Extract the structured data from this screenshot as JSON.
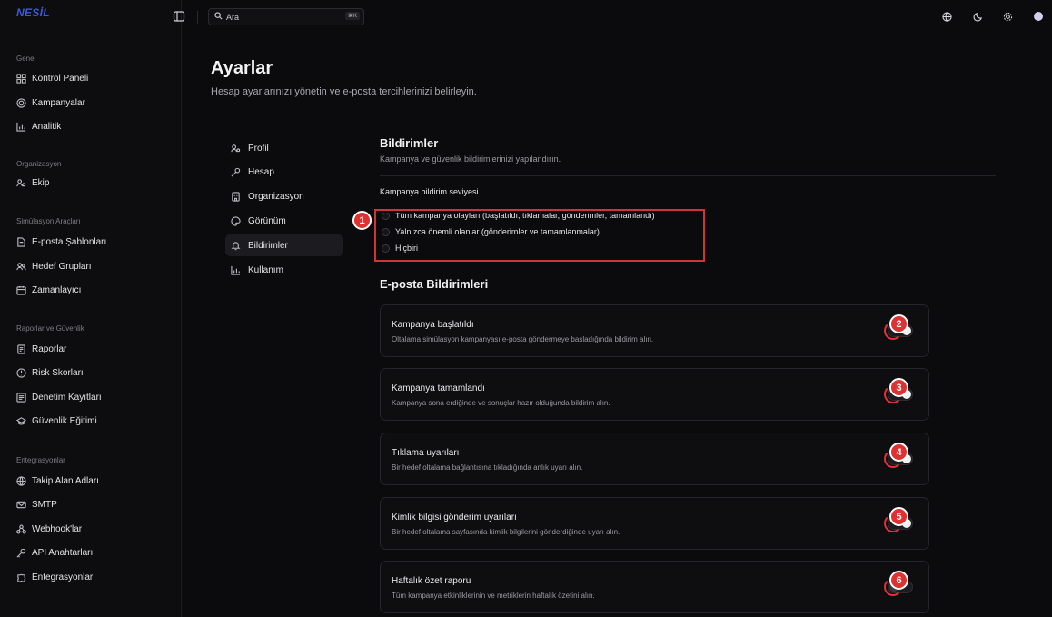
{
  "brand": {
    "logo": "NESİL"
  },
  "topbar": {
    "search_placeholder": "Ara",
    "search_shortcut": "⌘K",
    "icons": [
      "sidebar-toggle-icon",
      "globe-icon",
      "moon-icon",
      "gear-icon",
      "avatar"
    ]
  },
  "sidebar": {
    "sections": [
      {
        "title": "Genel",
        "items": [
          {
            "label": "Kontrol Paneli",
            "icon": "grid-icon"
          },
          {
            "label": "Kampanyalar",
            "icon": "target-icon"
          },
          {
            "label": "Analitik",
            "icon": "chart-icon"
          }
        ]
      },
      {
        "title": "Organizasyon",
        "items": [
          {
            "label": "Ekip",
            "icon": "users-icon"
          }
        ]
      },
      {
        "title": "Simülasyon Araçları",
        "items": [
          {
            "label": "E-posta Şablonları",
            "icon": "file-icon"
          },
          {
            "label": "Hedef Grupları",
            "icon": "group-icon"
          },
          {
            "label": "Zamanlayıcı",
            "icon": "calendar-icon"
          }
        ]
      },
      {
        "title": "Raporlar ve Güvenlik",
        "items": [
          {
            "label": "Raporlar",
            "icon": "report-icon"
          },
          {
            "label": "Risk Skorları",
            "icon": "shield-icon"
          },
          {
            "label": "Denetim Kayıtları",
            "icon": "log-icon"
          },
          {
            "label": "Güvenlik Eğitimi",
            "icon": "graduation-icon"
          }
        ]
      },
      {
        "title": "Entegrasyonlar",
        "items": [
          {
            "label": "Takip Alan Adları",
            "icon": "globe-icon"
          },
          {
            "label": "SMTP",
            "icon": "mail-icon"
          },
          {
            "label": "Webhook'lar",
            "icon": "webhook-icon"
          },
          {
            "label": "API Anahtarları",
            "icon": "key-icon"
          },
          {
            "label": "Entegrasyonlar",
            "icon": "puzzle-icon"
          }
        ]
      }
    ]
  },
  "page": {
    "title": "Ayarlar",
    "subtitle": "Hesap ayarlarınızı yönetin ve e-posta tercihlerinizi belirleyin."
  },
  "settings_nav": [
    {
      "label": "Profil",
      "icon": "user-icon",
      "active": false
    },
    {
      "label": "Hesap",
      "icon": "key-icon",
      "active": false
    },
    {
      "label": "Organizasyon",
      "icon": "building-icon",
      "active": false
    },
    {
      "label": "Görünüm",
      "icon": "palette-icon",
      "active": false
    },
    {
      "label": "Bildirimler",
      "icon": "bell-icon",
      "active": true
    },
    {
      "label": "Kullanım",
      "icon": "chart-icon",
      "active": false
    }
  ],
  "notifications": {
    "title": "Bildirimler",
    "subtitle": "Kampanya ve güvenlik bildirimlerinizi yapılandırın.",
    "level_label": "Kampanya bildirim seviyesi",
    "options": [
      "Tüm kampanya olayları (başlatıldı, tıklamalar, gönderimler, tamamlandı)",
      "Yalnızca önemli olanlar (gönderimler ve tamamlanmalar)",
      "Hiçbiri"
    ]
  },
  "email_notifications": {
    "title": "E-posta Bildirimleri",
    "items": [
      {
        "title": "Kampanya başlatıldı",
        "desc": "Oltalama simülasyon kampanyası e-posta göndermeye başladığında bildirim alın.",
        "badge": "2",
        "enabled": true
      },
      {
        "title": "Kampanya tamamlandı",
        "desc": "Kampanya sona erdiğinde ve sonuçlar hazır olduğunda bildirim alın.",
        "badge": "3",
        "enabled": true
      },
      {
        "title": "Tıklama uyarıları",
        "desc": "Bir hedef oltalama bağlantısına tıkladığında anlık uyarı alın.",
        "badge": "4",
        "enabled": true
      },
      {
        "title": "Kimlik bilgisi gönderim uyarıları",
        "desc": "Bir hedef oltalama sayfasında kimlik bilgilerini gönderdiğinde uyarı alın.",
        "badge": "5",
        "enabled": true
      },
      {
        "title": "Haftalık özet raporu",
        "desc": "Tüm kampanya etkinliklerinin ve metriklerin haftalık özetini alın.",
        "badge": "6",
        "enabled": false
      }
    ]
  },
  "annotations": {
    "radio_group_badge": "1"
  },
  "colors": {
    "accent": "#e03131",
    "brand": "#3b5bdb",
    "background": "#0b0b0d"
  }
}
